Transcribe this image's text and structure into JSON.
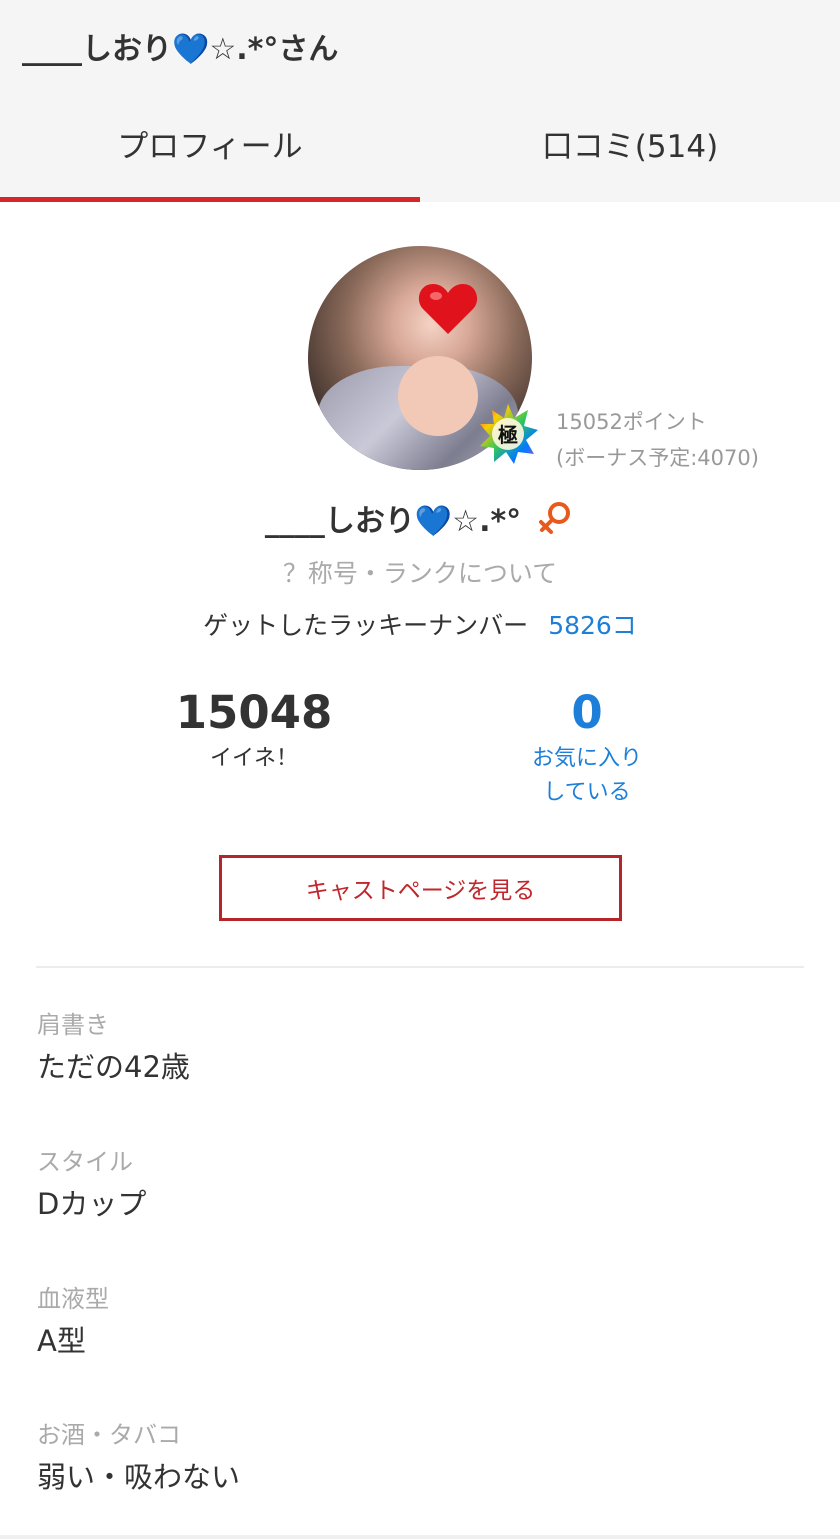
{
  "header": {
    "title": "____しおり💙☆.*°さん",
    "tabs": [
      {
        "label": "プロフィール",
        "active": true
      },
      {
        "label": "口コミ(514)",
        "active": false
      }
    ],
    "accent_color": "#d6262a"
  },
  "profile": {
    "name": "____しおり💙☆.*°",
    "rank_badge_text": "極",
    "points": "15052ポイント",
    "bonus": "(ボーナス予定:4070)",
    "rank_link": "？称号・ランクについて",
    "lucky_label": "ゲットしたラッキーナンバー",
    "lucky_count": "5826コ",
    "gender_icon": "female-icon"
  },
  "stats": {
    "likes_value": "15048",
    "likes_label": "イイネ！",
    "favs_value": "0",
    "favs_label_1": "お気に入り",
    "favs_label_2": "している"
  },
  "cast_button": "キャストページを見る",
  "fields": [
    {
      "label": "肩書き",
      "value": "ただの42歳"
    },
    {
      "label": "スタイル",
      "value": "Dカップ"
    },
    {
      "label": "血液型",
      "value": "A型"
    },
    {
      "label": "お酒・タバコ",
      "value": "弱い・吸わない"
    }
  ]
}
